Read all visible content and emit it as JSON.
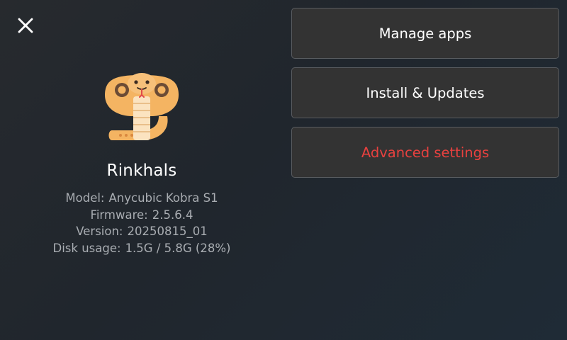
{
  "header": {
    "close_icon": "close-icon"
  },
  "app": {
    "name": "Rinkhals",
    "logo_icon": "cobra-logo-icon",
    "info": {
      "model_label": "Model:",
      "model_value": "Anycubic Kobra S1",
      "firmware_label": "Firmware:",
      "firmware_value": "2.5.6.4",
      "version_label": "Version:",
      "version_value": "20250815_01",
      "disk_label": "Disk usage:",
      "disk_value": "1.5G / 5.8G (28%)"
    }
  },
  "menu": {
    "manage_apps": "Manage apps",
    "install_updates": "Install & Updates",
    "advanced_settings": "Advanced settings"
  },
  "colors": {
    "danger": "#e8413f",
    "button_bg": "#333333",
    "button_border": "#595c60",
    "logo_orange": "#f4b462",
    "logo_cream": "#fbe3c0"
  }
}
